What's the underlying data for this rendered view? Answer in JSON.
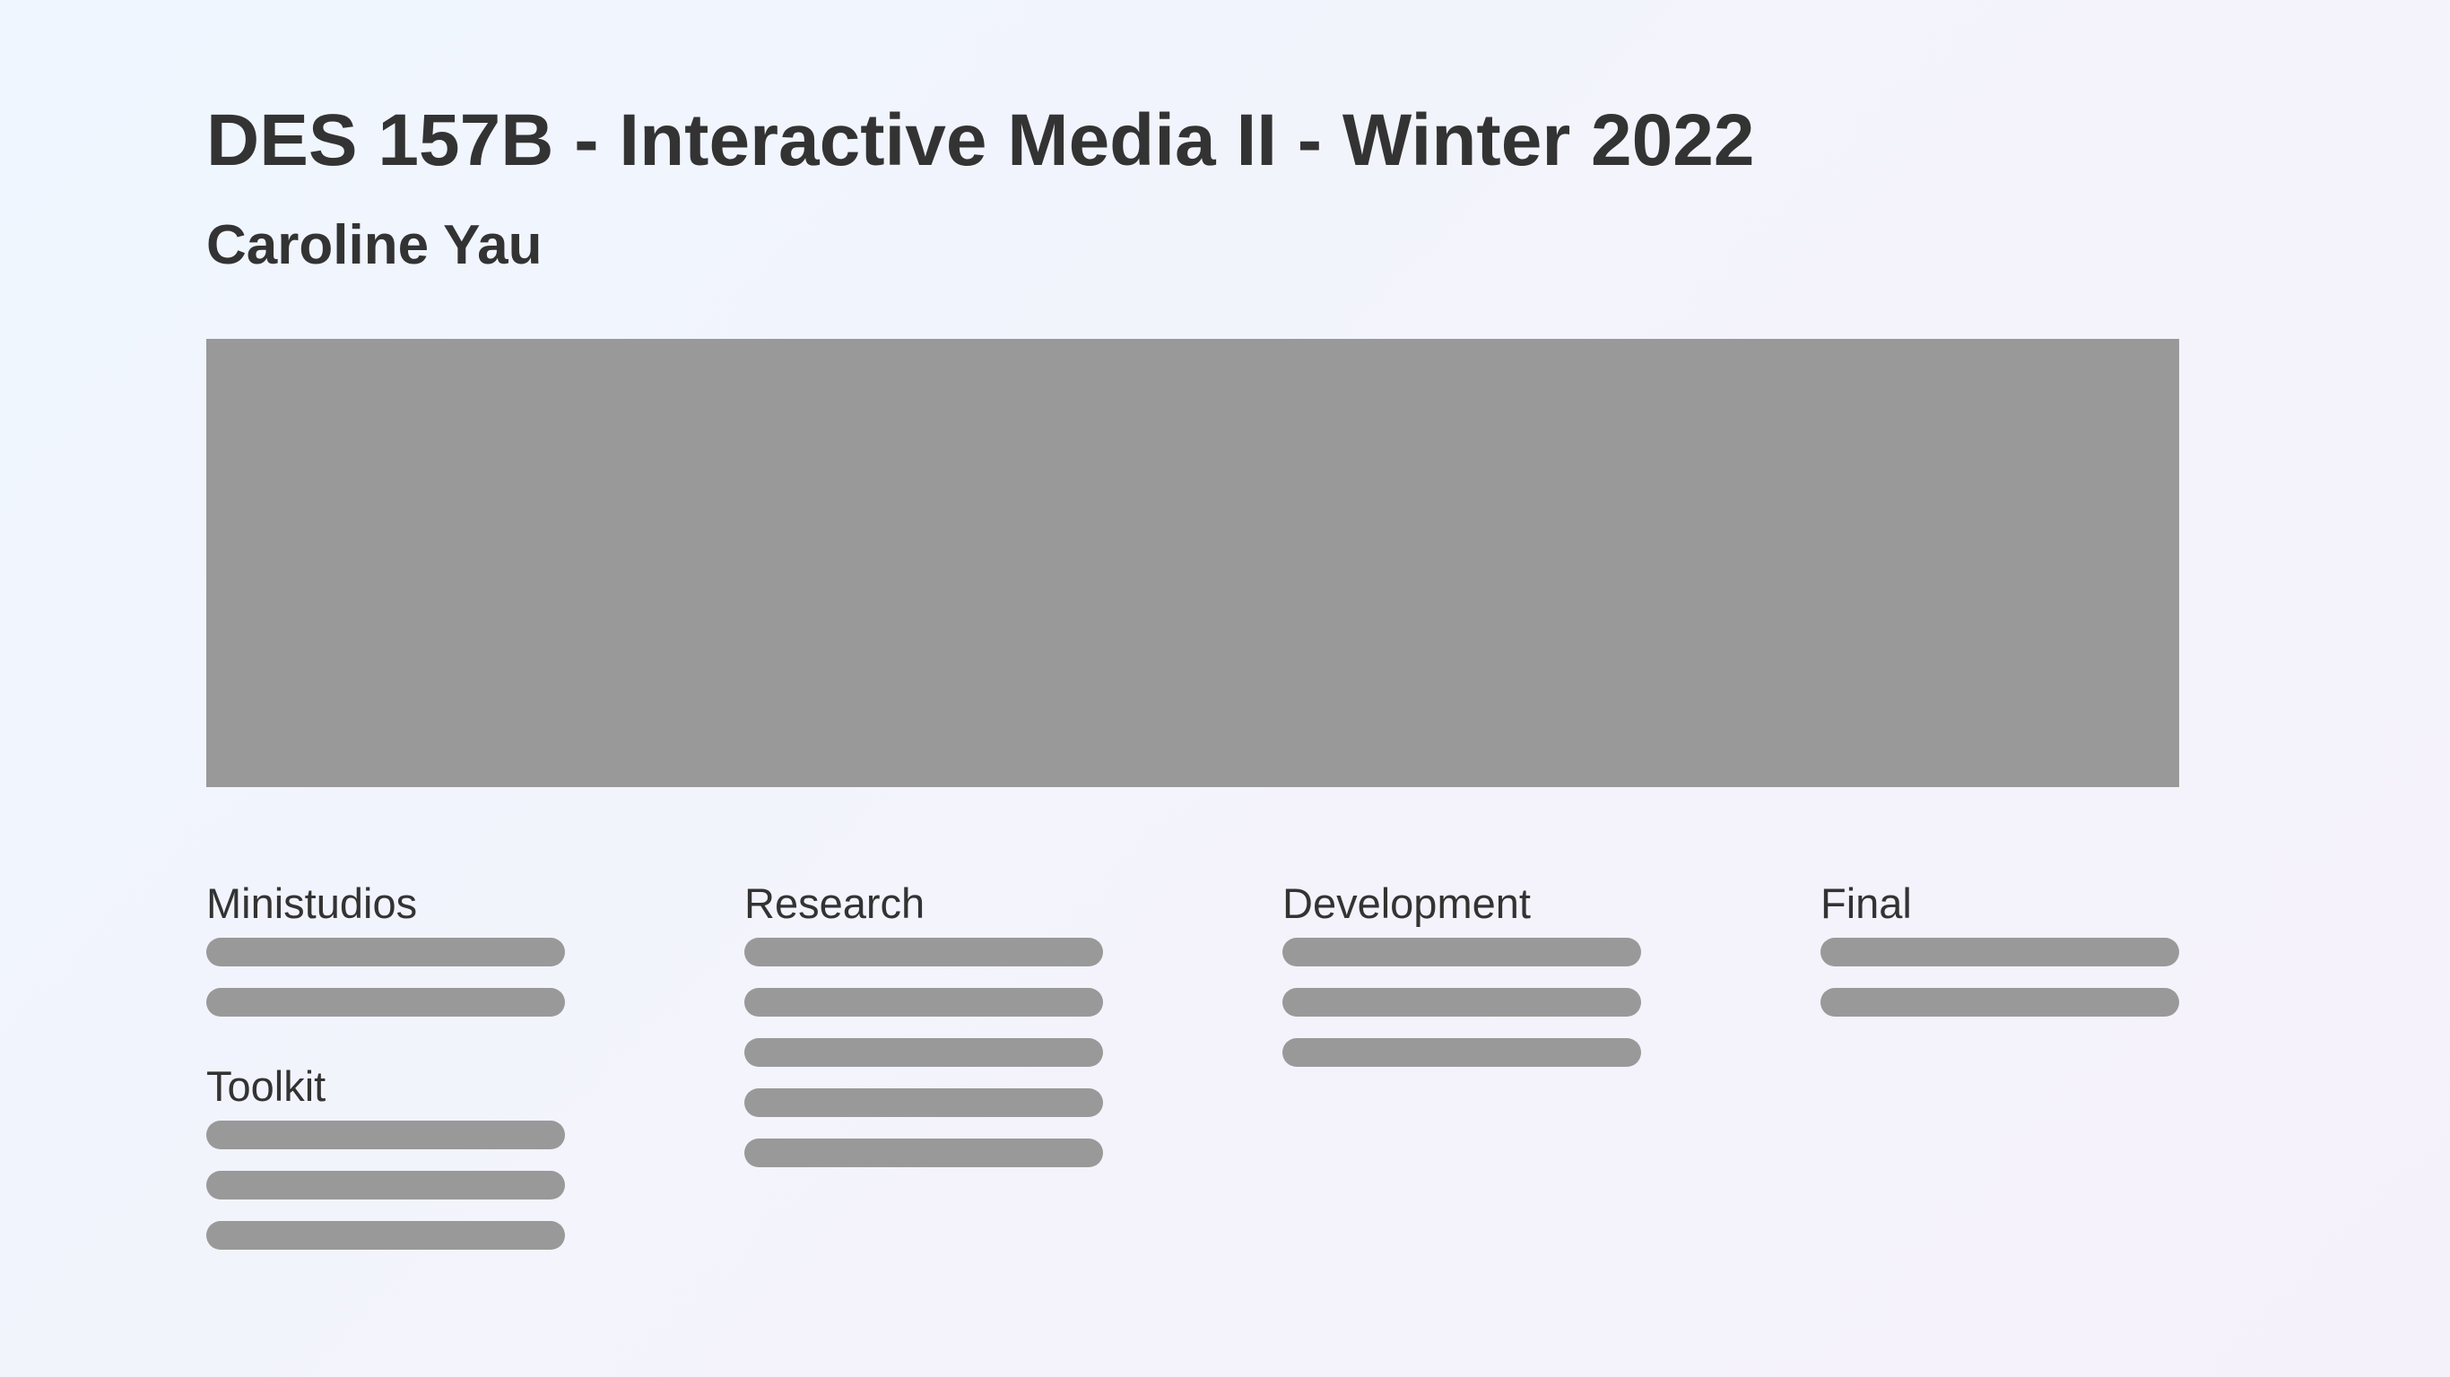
{
  "header": {
    "title": "DES 157B - Interactive Media II - Winter 2022",
    "author": "Caroline Yau"
  },
  "colors": {
    "background": "#f1f4fc",
    "text": "#333333",
    "placeholder": "#999999"
  },
  "columns": [
    {
      "sections": [
        {
          "heading": "Ministudios",
          "link_count": 2
        },
        {
          "heading": "Toolkit",
          "link_count": 3
        }
      ]
    },
    {
      "sections": [
        {
          "heading": "Research",
          "link_count": 5
        }
      ]
    },
    {
      "sections": [
        {
          "heading": "Development",
          "link_count": 3
        }
      ]
    },
    {
      "sections": [
        {
          "heading": "Final",
          "link_count": 2
        }
      ]
    }
  ]
}
